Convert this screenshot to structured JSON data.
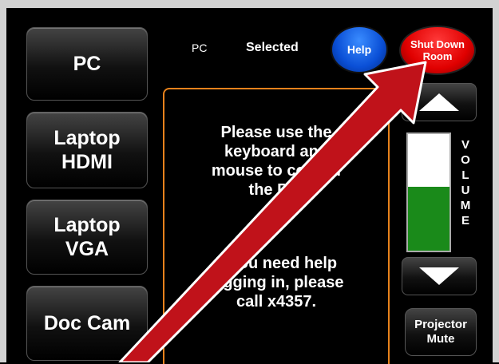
{
  "sources": [
    {
      "label": "PC"
    },
    {
      "label": "Laptop\nHDMI"
    },
    {
      "label": "Laptop\nVGA"
    },
    {
      "label": "Doc Cam"
    }
  ],
  "status": {
    "current_source": "PC",
    "selected_label": "Selected"
  },
  "buttons": {
    "help_label": "Help",
    "shutdown_label": "Shut Down\nRoom",
    "mute_label": "Projector\nMute"
  },
  "message": {
    "line1": "Please use the\nkeyboard and\nmouse to control\nthe PC.",
    "line2": "If you need help\nlogging in, please\ncall x4357."
  },
  "volume": {
    "label": "VOLUME",
    "level": 0.55,
    "up_icon": "triangle-up-icon",
    "down_icon": "triangle-down-icon"
  },
  "colors": {
    "help": "#0a4fd6",
    "shutdown": "#e00000",
    "volume_fill": "#1a8a1a",
    "message_border": "#e8821c",
    "annotation_arrow": "#c0121a"
  }
}
